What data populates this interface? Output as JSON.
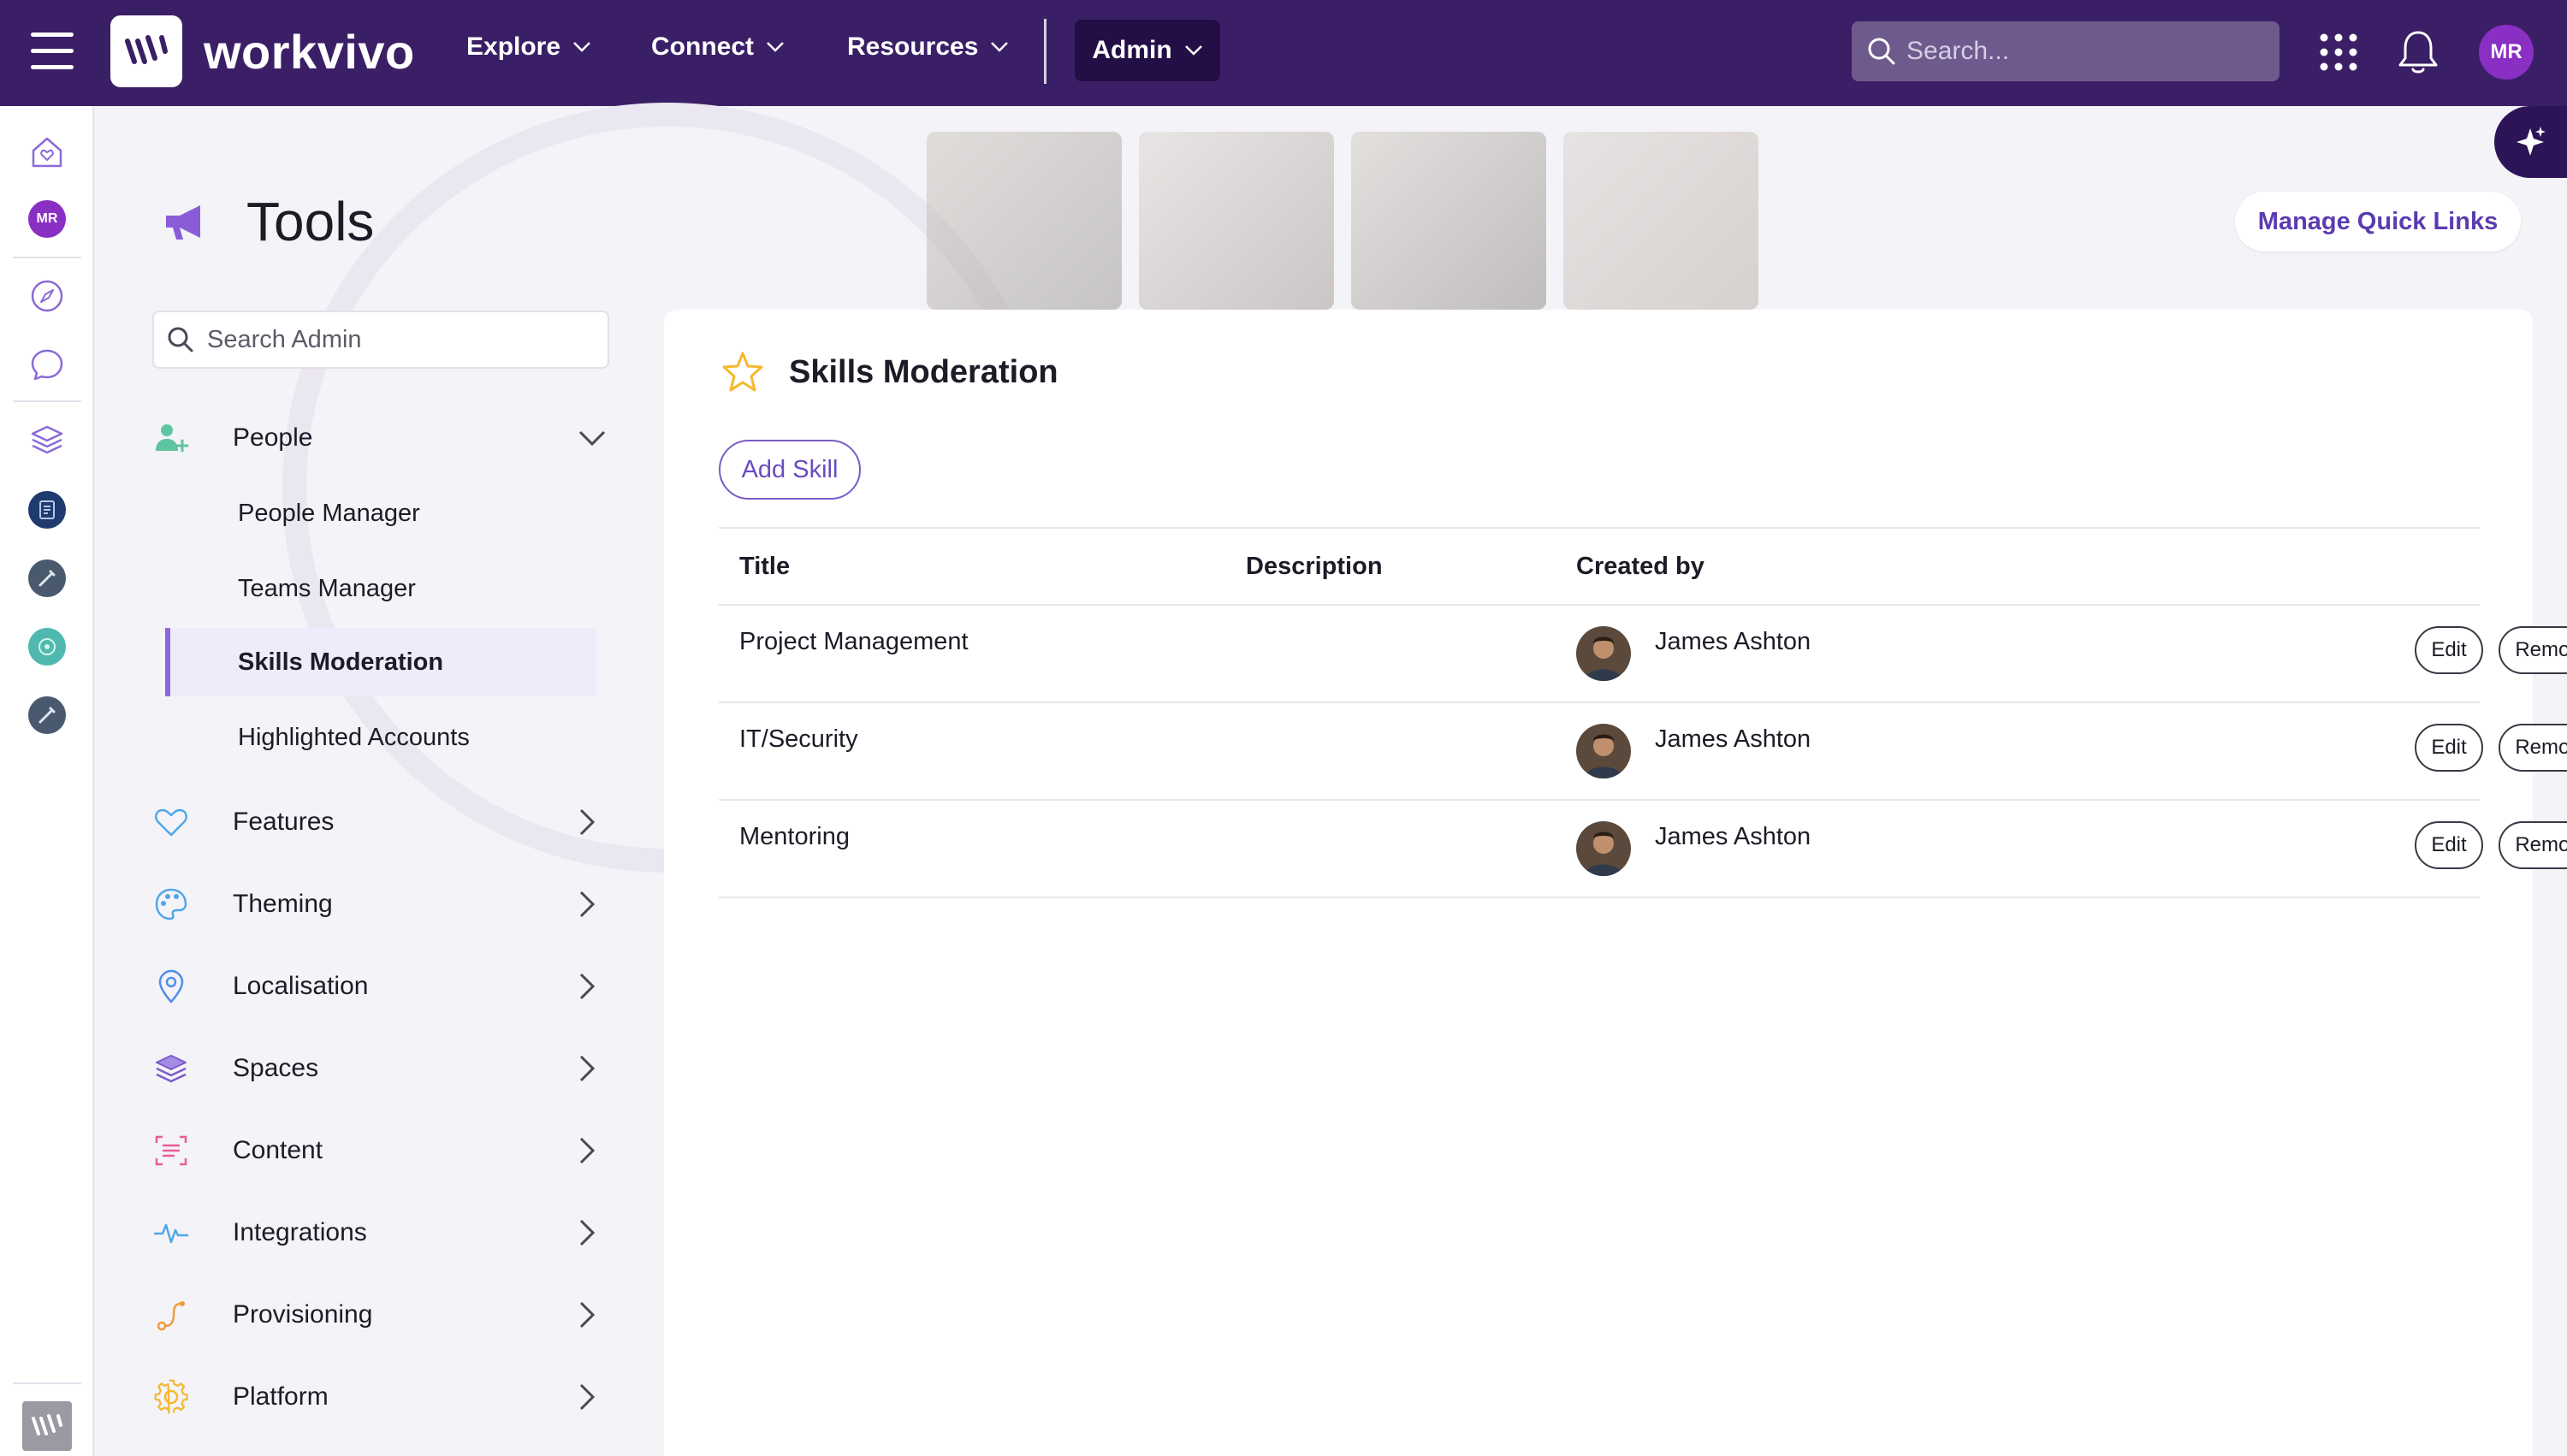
{
  "app": {
    "logo_text": "workvivo"
  },
  "topnav": {
    "items": [
      {
        "label": "Explore"
      },
      {
        "label": "Connect"
      },
      {
        "label": "Resources"
      }
    ],
    "admin_label": "Admin",
    "search_placeholder": "Search...",
    "avatar_initials": "MR"
  },
  "rail": {
    "avatar_initials": "MR"
  },
  "page": {
    "title": "Tools",
    "quick_links_label": "Manage Quick Links"
  },
  "sidebar": {
    "search_placeholder": "Search Admin",
    "people": {
      "label": "People",
      "items": [
        {
          "label": "People Manager"
        },
        {
          "label": "Teams Manager"
        },
        {
          "label": "Skills Moderation",
          "active": true
        },
        {
          "label": "Highlighted Accounts"
        }
      ]
    },
    "sections": [
      {
        "label": "Features",
        "icon": "heart-icon",
        "color": "#4fa7e8"
      },
      {
        "label": "Theming",
        "icon": "palette-icon",
        "color": "#4fa7e8"
      },
      {
        "label": "Localisation",
        "icon": "map-pin-icon",
        "color": "#4f8ee8"
      },
      {
        "label": "Spaces",
        "icon": "layers-icon",
        "color": "#7a5cc8"
      },
      {
        "label": "Content",
        "icon": "content-icon",
        "color": "#e85c9a"
      },
      {
        "label": "Integrations",
        "icon": "pulse-icon",
        "color": "#4fa7e8"
      },
      {
        "label": "Provisioning",
        "icon": "route-icon",
        "color": "#f0993c"
      },
      {
        "label": "Platform",
        "icon": "gear-icon",
        "color": "#f5b82e"
      }
    ]
  },
  "skills": {
    "title": "Skills Moderation",
    "add_label": "Add Skill",
    "columns": {
      "title": "Title",
      "description": "Description",
      "created_by": "Created by"
    },
    "rows": [
      {
        "title": "Project Management",
        "description": "",
        "created_by": "James Ashton"
      },
      {
        "title": "IT/Security",
        "description": "",
        "created_by": "James Ashton"
      },
      {
        "title": "Mentoring",
        "description": "",
        "created_by": "James Ashton"
      }
    ],
    "edit_label": "Edit",
    "remove_label": "Remove"
  },
  "colors": {
    "topbar": "#3b1f66",
    "accent": "#7a5cc8",
    "star": "#f5b82e"
  }
}
